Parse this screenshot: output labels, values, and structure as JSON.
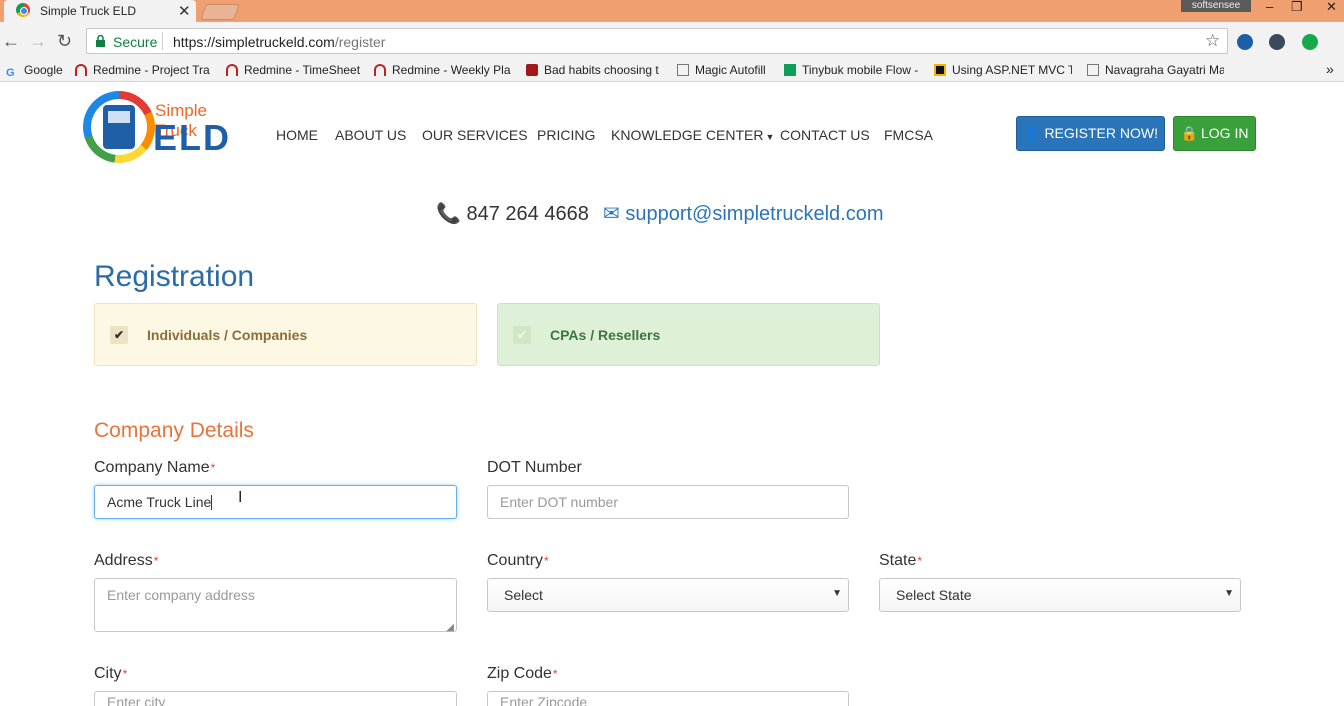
{
  "browser": {
    "tab_title": "Simple Truck ELD",
    "tab_close": "✕",
    "user": "softsensee",
    "window_controls": [
      "–",
      "❐",
      "✕"
    ],
    "secure_label": "Secure",
    "url_base": "https://simpletruckeld.com",
    "url_path": "/register",
    "more_bookmarks": "»",
    "bookmarks": [
      "Google",
      "Redmine - Project Tra",
      "Redmine - TimeSheet",
      "Redmine - Weekly Pla",
      "Bad habits choosing t",
      "Magic Autofill",
      "Tinybuk mobile Flow -",
      "Using ASP.NET MVC T",
      "Navagraha Gayatri Ma"
    ]
  },
  "logo": {
    "line1": "Simple Truck",
    "line2": "ELD"
  },
  "nav": [
    "HOME",
    "ABOUT US",
    "OUR SERVICES",
    "PRICING",
    "KNOWLEDGE CENTER",
    "CONTACT US",
    "FMCSA"
  ],
  "buttons": {
    "register": "REGISTER NOW!",
    "login": "LOG IN"
  },
  "contact": {
    "phone": "847 264 4668",
    "email": "support@simpletruckeld.com"
  },
  "registration": {
    "title": "Registration",
    "types": [
      {
        "label": "Individuals / Companies",
        "selected": true
      },
      {
        "label": "CPAs / Resellers",
        "selected": false
      }
    ]
  },
  "company": {
    "title": "Company Details",
    "fields": {
      "company_name": {
        "label": "Company Name",
        "value": "Acme Truck Line",
        "required": "*"
      },
      "dot_number": {
        "label": "DOT Number",
        "placeholder": "Enter DOT number"
      },
      "address": {
        "label": "Address",
        "placeholder": "Enter company address",
        "required": "*"
      },
      "country": {
        "label": "Country",
        "value": "Select",
        "required": "*"
      },
      "state": {
        "label": "State",
        "value": "Select State",
        "required": "*"
      },
      "city": {
        "label": "City",
        "placeholder": "Enter city",
        "required": "*"
      },
      "zip": {
        "label": "Zip Code",
        "placeholder": "Enter Zipcode",
        "required": "*"
      }
    }
  },
  "colors": {
    "brand_blue": "#2a75ba",
    "login_green": "#3aa03a",
    "section_orange": "#e8733b",
    "heading_blue": "#2a6ba8"
  }
}
